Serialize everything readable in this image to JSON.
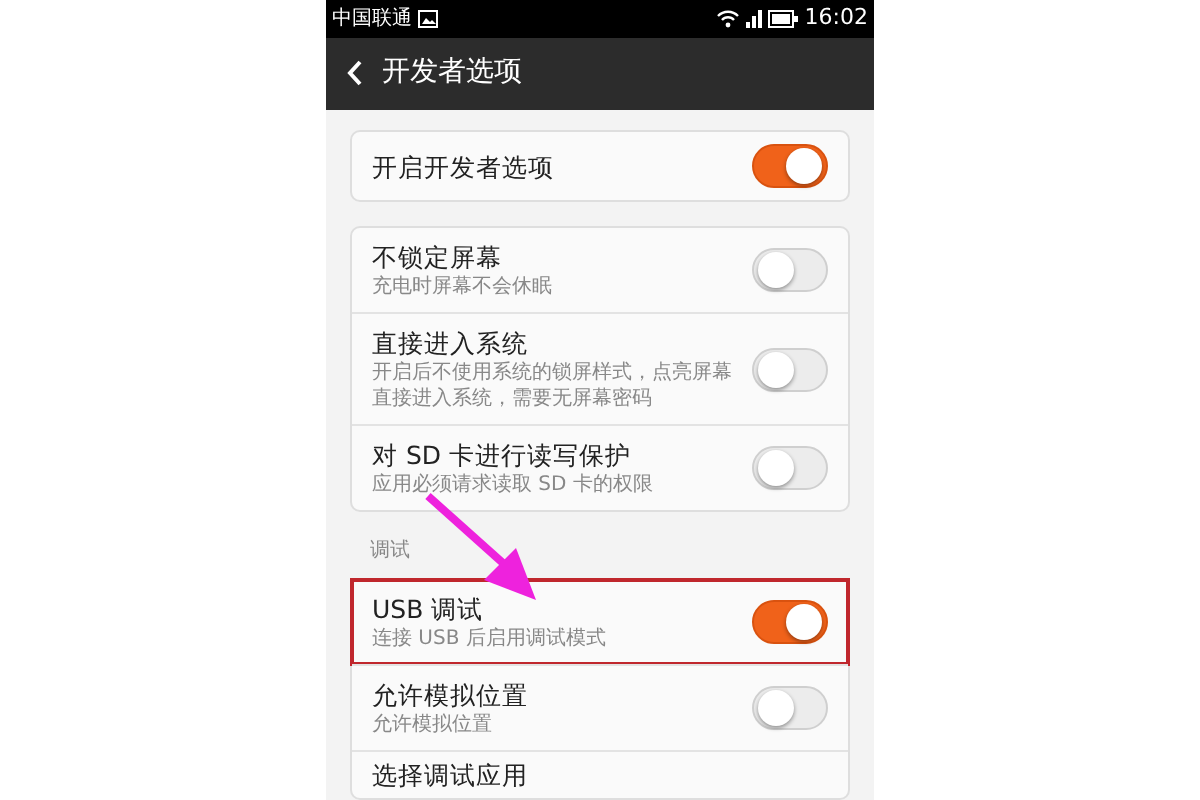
{
  "status_bar": {
    "carrier": "中国联通",
    "time": "16:02"
  },
  "action_bar": {
    "title": "开发者选项"
  },
  "groups": [
    {
      "items": [
        {
          "title": "开启开发者选项",
          "on": true,
          "highlighted": false
        }
      ]
    },
    {
      "items": [
        {
          "title": "不锁定屏幕",
          "subtitle": "充电时屏幕不会休眠",
          "on": false,
          "highlighted": false
        },
        {
          "title": "直接进入系统",
          "subtitle": "开启后不使用系统的锁屏样式，点亮屏幕直接进入系统，需要无屏幕密码",
          "on": false,
          "highlighted": false
        },
        {
          "title": "对 SD 卡进行读写保护",
          "subtitle": "应用必须请求读取 SD 卡的权限",
          "on": false,
          "highlighted": false
        }
      ]
    },
    {
      "label": "调试",
      "items": [
        {
          "title": "USB 调试",
          "subtitle": "连接 USB 后启用调试模式",
          "on": true,
          "highlighted": true
        },
        {
          "title": "允许模拟位置",
          "subtitle": "允许模拟位置",
          "on": false,
          "highlighted": false
        },
        {
          "title": "选择调试应用",
          "highlighted": false
        }
      ]
    }
  ]
}
